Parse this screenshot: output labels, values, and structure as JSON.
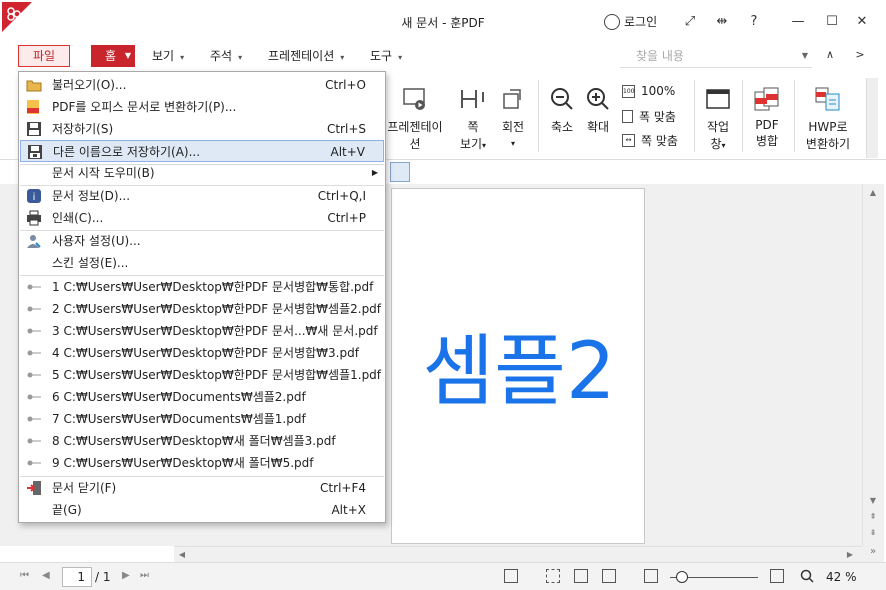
{
  "window": {
    "title": "새 문서 - 훈PDF",
    "login_label": "로그인",
    "help_label": "?"
  },
  "menubar": {
    "file_label": "파일",
    "home_label": "홈",
    "items": [
      {
        "label": "보기"
      },
      {
        "label": "주석"
      },
      {
        "label": "프레젠테이션"
      },
      {
        "label": "도구"
      }
    ],
    "search_placeholder": "찾을 내용"
  },
  "ribbon": {
    "presentation_label": "프레젠테이션",
    "page_view_label_1": "쪽",
    "page_view_label_2": "보기",
    "rotate_label": "회전",
    "zoom_out_label": "축소",
    "zoom_in_label": "확대",
    "zoom_100_label": "100%",
    "fit_width_label": "폭 맞춤",
    "fit_page_label": "쪽 맞춤",
    "workspace_label_1": "작업",
    "workspace_label_2": "창",
    "pdf_merge_label_1": "PDF",
    "pdf_merge_label_2": "병합",
    "hwp_convert_label_1": "HWP로",
    "hwp_convert_label_2": "변환하기"
  },
  "file_menu": {
    "open": {
      "label": "불러오기(O)...",
      "shortcut": "Ctrl+O"
    },
    "convert_office": {
      "label": "PDF를 오피스 문서로 변환하기(P)..."
    },
    "save": {
      "label": "저장하기(S)",
      "shortcut": "Ctrl+S"
    },
    "save_as": {
      "label": "다른 이름으로 저장하기(A)...",
      "shortcut": "Alt+V"
    },
    "wizard": {
      "label": "문서 시작 도우미(B)"
    },
    "doc_info": {
      "label": "문서 정보(D)...",
      "shortcut": "Ctrl+Q,I"
    },
    "print": {
      "label": "인쇄(C)...",
      "shortcut": "Ctrl+P"
    },
    "user_settings": {
      "label": "사용자 설정(U)..."
    },
    "skin_settings": {
      "label": "스킨 설정(E)..."
    },
    "recent": [
      "1 C:₩Users₩User₩Desktop₩한PDF 문서병합₩통합.pdf",
      "2 C:₩Users₩User₩Desktop₩한PDF 문서병합₩셈플2.pdf",
      "3 C:₩Users₩User₩Desktop₩한PDF 문서...₩새 문서.pdf",
      "4 C:₩Users₩User₩Desktop₩한PDF 문서병합₩3.pdf",
      "5 C:₩Users₩User₩Desktop₩한PDF 문서병합₩셈플1.pdf",
      "6 C:₩Users₩User₩Documents₩셈플2.pdf",
      "7 C:₩Users₩User₩Documents₩셈플1.pdf",
      "8 C:₩Users₩User₩Desktop₩새 폴더₩셈플3.pdf",
      "9 C:₩Users₩User₩Desktop₩새 폴더₩5.pdf"
    ],
    "close_doc": {
      "label": "문서 닫기(F)",
      "shortcut": "Ctrl+F4"
    },
    "exit": {
      "label": "끝(G)",
      "shortcut": "Alt+X"
    }
  },
  "document": {
    "page_text": "셈플2"
  },
  "statusbar": {
    "current_page": "1",
    "total_pages": "/ 1",
    "zoom": "42 %"
  },
  "colors": {
    "accent_red": "#c9252c",
    "page_text_blue": "#1a73e8",
    "highlight": "#dfe9f6"
  }
}
